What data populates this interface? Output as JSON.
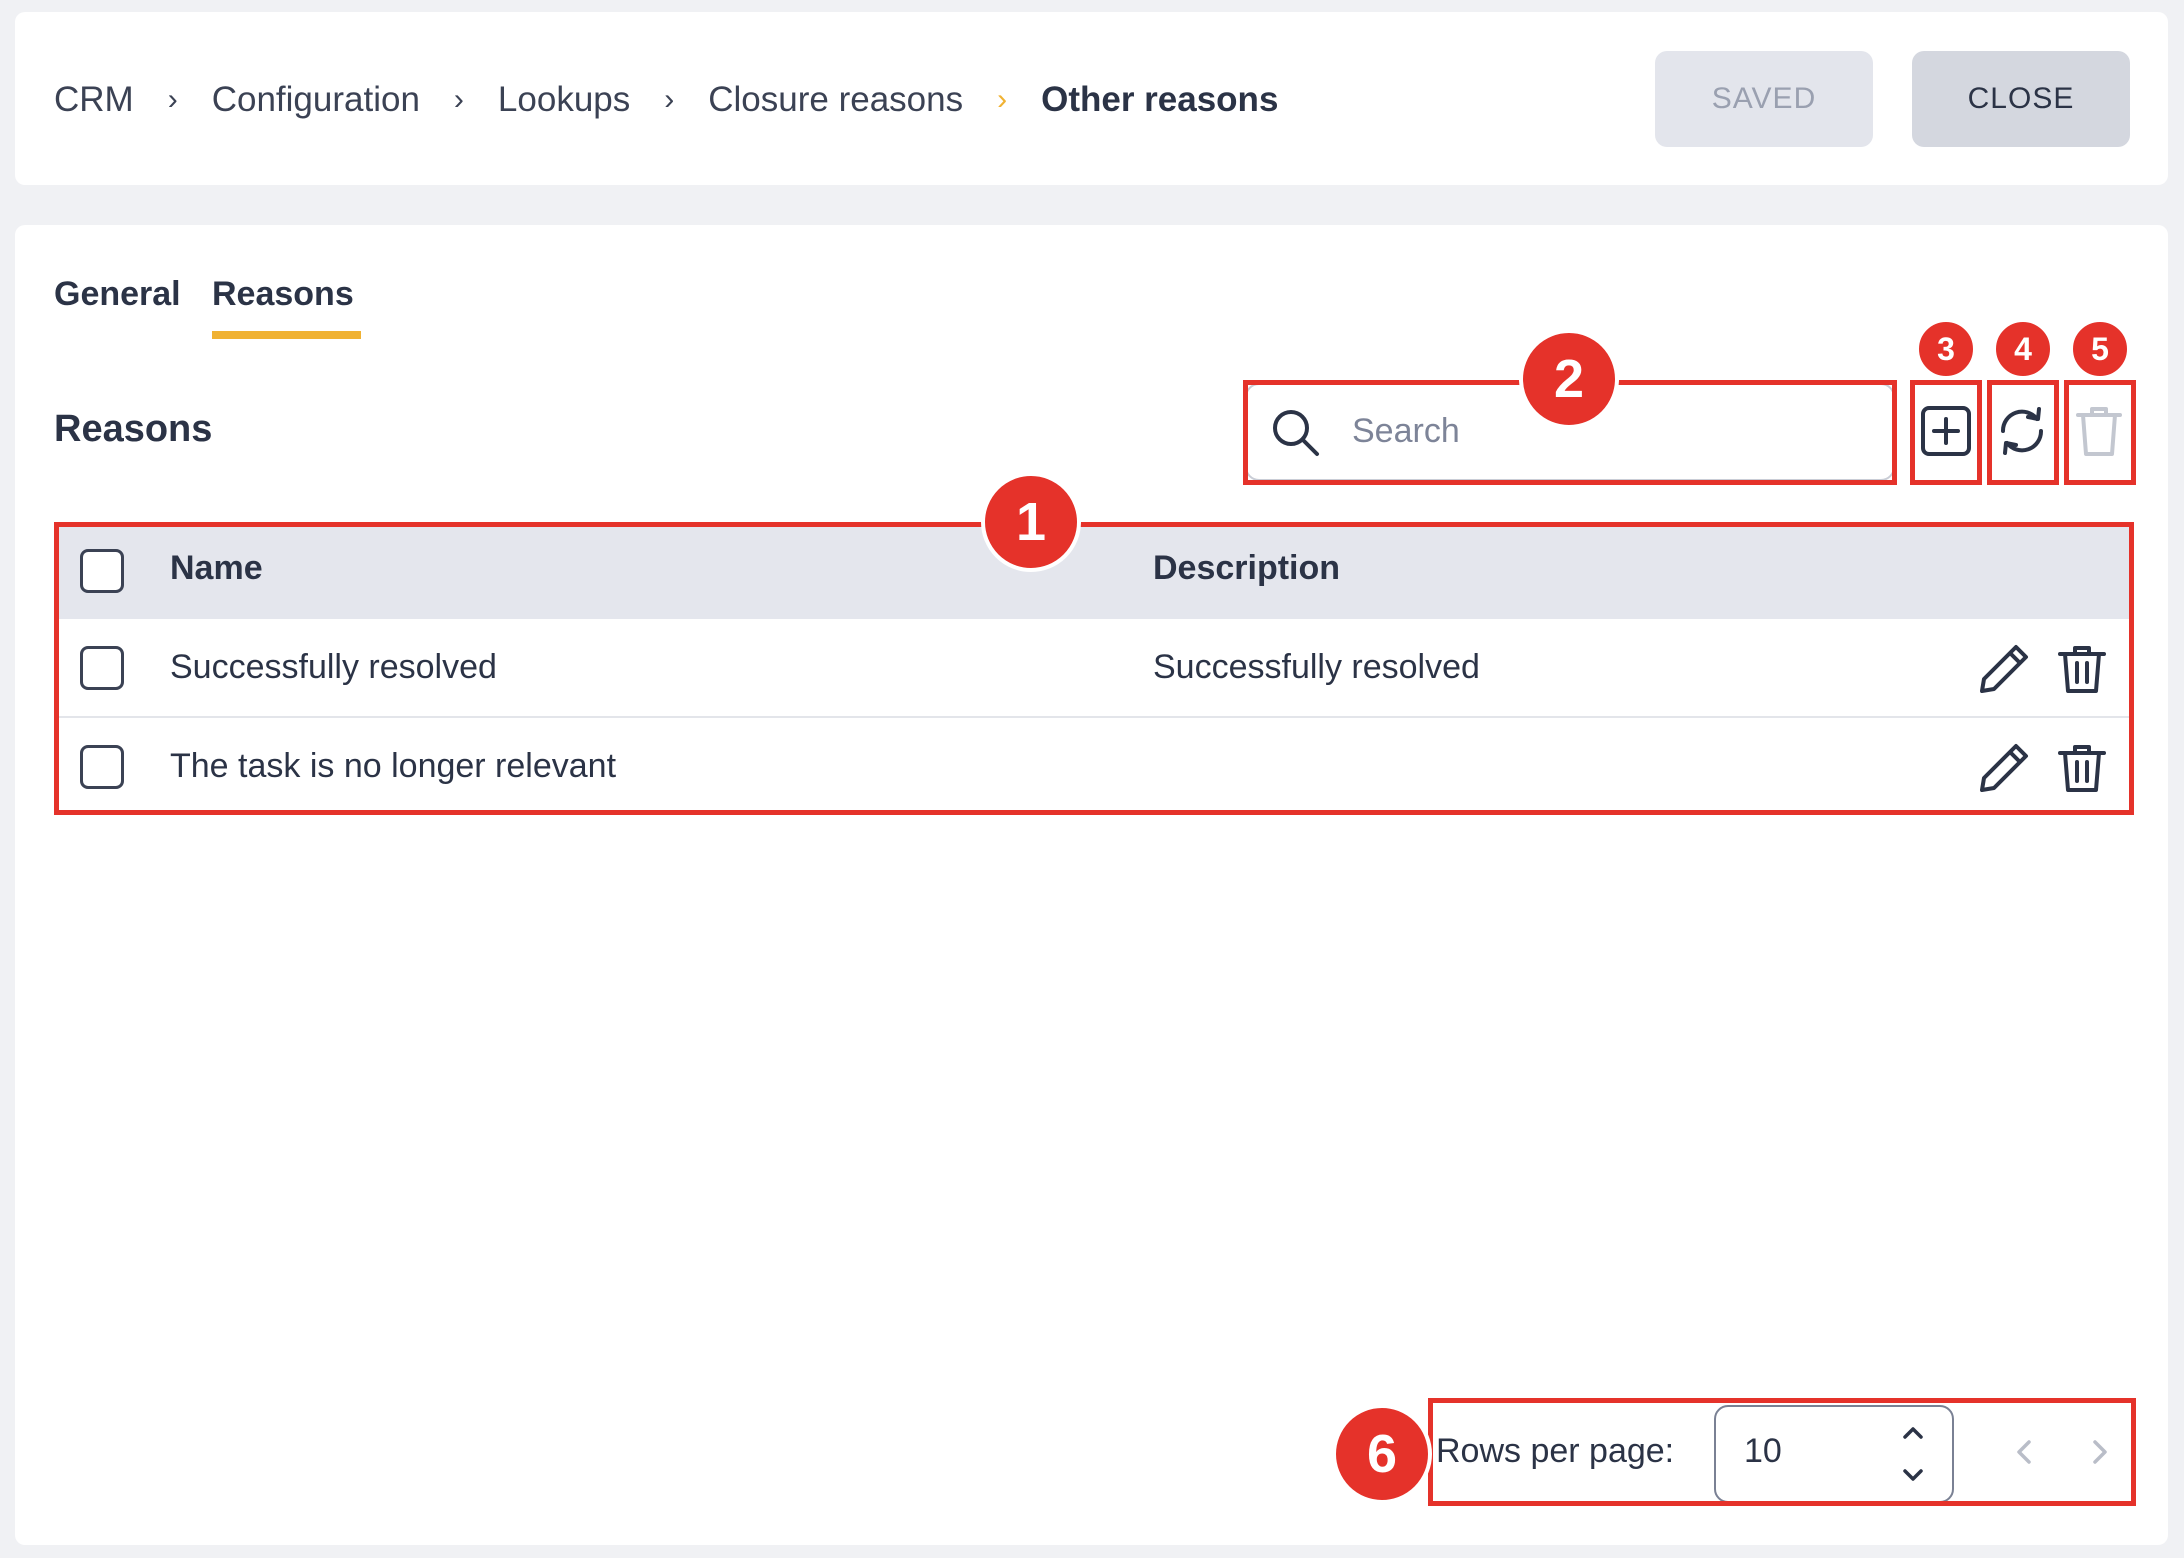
{
  "breadcrumb": {
    "items": [
      "CRM",
      "Configuration",
      "Lookups",
      "Closure reasons"
    ],
    "current": "Other reasons"
  },
  "header": {
    "saved_label": "SAVED",
    "close_label": "CLOSE"
  },
  "tabs": [
    {
      "label": "General",
      "active": false
    },
    {
      "label": "Reasons",
      "active": true
    }
  ],
  "section": {
    "title": "Reasons"
  },
  "search": {
    "placeholder": "Search",
    "value": ""
  },
  "toolbar": {
    "add_icon": "plus-square-icon",
    "refresh_icon": "refresh-icon",
    "delete_icon": "trash-icon"
  },
  "table": {
    "columns": [
      "Name",
      "Description"
    ],
    "rows": [
      {
        "name": "Successfully resolved",
        "description": "Successfully resolved"
      },
      {
        "name": "The task is no longer relevant",
        "description": ""
      }
    ]
  },
  "pagination": {
    "rows_per_page_label": "Rows per page:",
    "rows_per_page": "10"
  },
  "annotations": [
    "1",
    "2",
    "3",
    "4",
    "5",
    "6"
  ],
  "colors": {
    "accent": "#f0b233",
    "annotation": "#e5322a",
    "header_row": "#e4e6ed",
    "background": "#f0f1f4"
  }
}
